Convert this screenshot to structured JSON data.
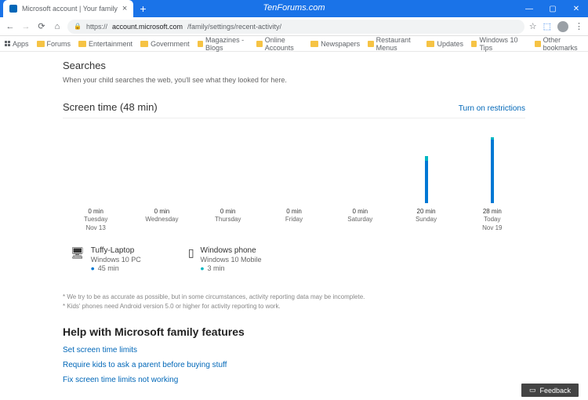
{
  "window": {
    "tab_title": "Microsoft account | Your family",
    "watermark": "TenForums.com",
    "controls": {
      "min": "—",
      "max": "▢",
      "close": "✕"
    }
  },
  "toolbar": {
    "url_scheme": "https://",
    "url_host": "account.microsoft.com",
    "url_path": "/family/settings/recent-activity/"
  },
  "bookmarks": {
    "apps": "Apps",
    "items": [
      "Forums",
      "Entertainment",
      "Government",
      "Magazines - Blogs",
      "Online Accounts",
      "Newspapers",
      "Restaurant Menus",
      "Updates",
      "Windows 10 Tips"
    ],
    "other": "Other bookmarks"
  },
  "searches": {
    "heading": "Searches",
    "subtitle": "When your child searches the web, you'll see what they looked for here."
  },
  "screentime": {
    "heading": "Screen time (48 min)",
    "restrictions_link": "Turn on restrictions"
  },
  "chart_data": {
    "type": "bar",
    "categories": [
      "Tuesday",
      "Wednesday",
      "Thursday",
      "Friday",
      "Saturday",
      "Sunday",
      "Today"
    ],
    "date_line1": [
      "Nov 13",
      "",
      "",
      "",
      "",
      "",
      "Nov 19"
    ],
    "series": [
      {
        "name": "Tuffy-Laptop",
        "values": [
          0,
          0,
          0,
          0,
          0,
          18,
          27
        ],
        "color": "#0078d4"
      },
      {
        "name": "Windows phone",
        "values": [
          0,
          0,
          0,
          0,
          0,
          2,
          1
        ],
        "color": "#00b7c3"
      }
    ],
    "value_labels": [
      "0 min",
      "0 min",
      "0 min",
      "0 min",
      "0 min",
      "20 min",
      "28 min"
    ],
    "ylim": [
      0,
      30
    ],
    "ylabel": "",
    "xlabel": "",
    "title": ""
  },
  "devices": [
    {
      "name": "Tuffy-Laptop",
      "platform": "Windows 10 PC",
      "time": "45 min",
      "icon": "laptop"
    },
    {
      "name": "Windows phone",
      "platform": "Windows 10 Mobile",
      "time": "3 min",
      "icon": "phone"
    }
  ],
  "disclaimers": [
    "* We try to be as accurate as possible, but in some circumstances, activity reporting data may be incomplete.",
    "* Kids' phones need Android version 5.0 or higher for activity reporting to work."
  ],
  "help": {
    "heading": "Help with Microsoft family features",
    "links": [
      "Set screen time limits",
      "Require kids to ask a parent before buying stuff",
      "Fix screen time limits not working"
    ]
  },
  "feedback": {
    "label": "Feedback"
  }
}
